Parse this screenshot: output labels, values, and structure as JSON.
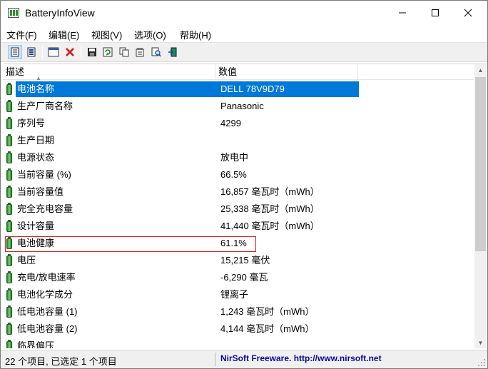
{
  "window": {
    "title": "BatteryInfoView"
  },
  "menu": [
    "文件(F)",
    "编辑(E)",
    "视图(V)",
    "选项(O)",
    "帮助(H)"
  ],
  "columns": {
    "desc": "描述",
    "value": "数值"
  },
  "rows": [
    {
      "desc": "电池名称",
      "value": "DELL 78V9D79"
    },
    {
      "desc": "生产厂商名称",
      "value": "Panasonic"
    },
    {
      "desc": "序列号",
      "value": "4299"
    },
    {
      "desc": "生产日期",
      "value": ""
    },
    {
      "desc": "电源状态",
      "value": "放电中"
    },
    {
      "desc": "当前容量 (%)",
      "value": "66.5%"
    },
    {
      "desc": "当前容量值",
      "value": "16,857 毫瓦时（mWh）"
    },
    {
      "desc": "完全充电容量",
      "value": "25,338 毫瓦时（mWh）"
    },
    {
      "desc": "设计容量",
      "value": "41,440 毫瓦时（mWh）"
    },
    {
      "desc": "电池健康",
      "value": "61.1%"
    },
    {
      "desc": "电压",
      "value": "15,215 毫伏"
    },
    {
      "desc": "充电/放电速率",
      "value": "-6,290 毫瓦"
    },
    {
      "desc": "电池化学成分",
      "value": "锂离子"
    },
    {
      "desc": "低电池容量 (1)",
      "value": "1,243 毫瓦时（mWh）"
    },
    {
      "desc": "低电池容量 (2)",
      "value": "4,144 毫瓦时（mWh）"
    },
    {
      "desc": "临界偏压",
      "value": ""
    }
  ],
  "status": {
    "items": "22 个项目, 已选定 1 个项目",
    "credit": "NirSoft Freeware.  http://www.nirsoft.net"
  },
  "colors": {
    "selection": "#0078d7",
    "highlight_box": "#e02020",
    "battery": "#2f8f2f"
  }
}
